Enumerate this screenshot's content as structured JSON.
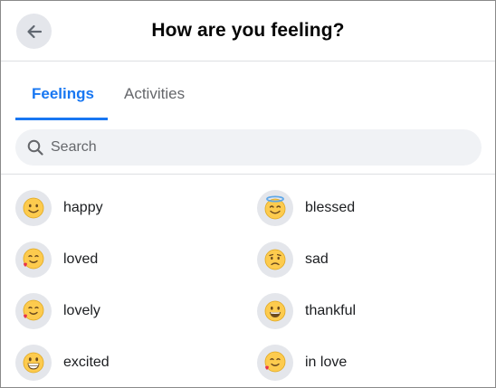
{
  "header": {
    "title": "How are you feeling?"
  },
  "tabs": [
    {
      "label": "Feelings"
    },
    {
      "label": "Activities"
    }
  ],
  "search": {
    "placeholder": "Search",
    "value": ""
  },
  "feelings": [
    {
      "label": "happy",
      "icon": "smiling-face-icon"
    },
    {
      "label": "blessed",
      "icon": "halo-face-icon"
    },
    {
      "label": "loved",
      "icon": "face-with-hearts-icon"
    },
    {
      "label": "sad",
      "icon": "sad-face-icon"
    },
    {
      "label": "lovely",
      "icon": "face-blowing-kiss-icon"
    },
    {
      "label": "thankful",
      "icon": "grinning-face-icon"
    },
    {
      "label": "excited",
      "icon": "grinning-face-big-eyes-icon"
    },
    {
      "label": "in love",
      "icon": "kissing-heart-face-icon"
    }
  ],
  "colors": {
    "accent": "#1877f2",
    "emoji_yellow": "#fdcb4e",
    "muted_text": "#65676b"
  }
}
